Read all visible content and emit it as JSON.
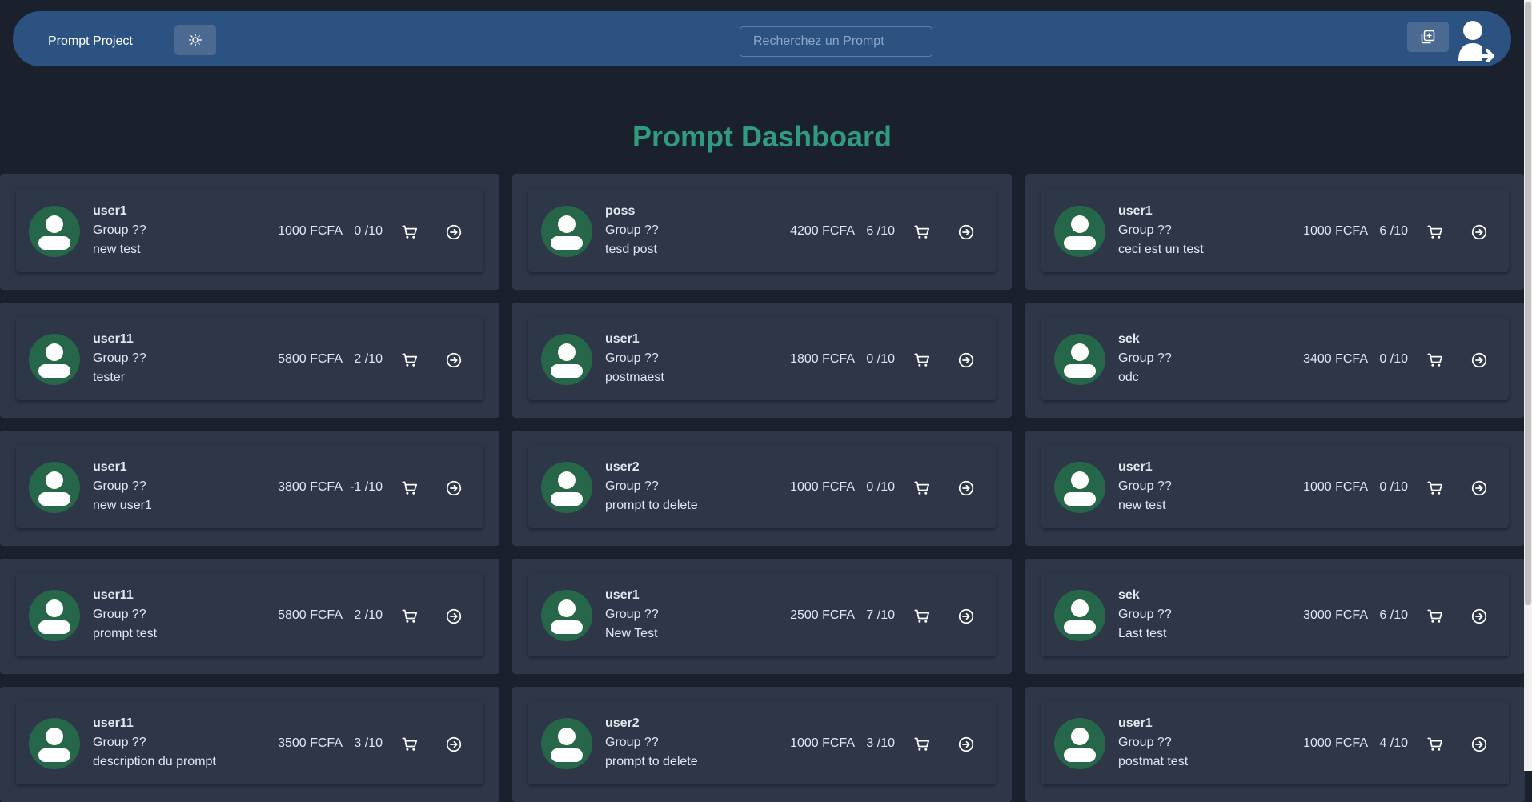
{
  "navbar": {
    "brand": "Prompt Project",
    "search_placeholder": "Recherchez un Prompt",
    "theme_icon": "sun-icon",
    "add_icon": "add-stack-icon",
    "user_icon": "user-logout-icon"
  },
  "page": {
    "title": "Prompt Dashboard"
  },
  "colors": {
    "background": "#1a202c",
    "navbar": "#2c5282",
    "card": "#2d3748",
    "title": "#319b7f",
    "avatar": "#276749"
  },
  "cards": [
    {
      "user": "user1",
      "group": "Group ??",
      "description": "new test",
      "price": "1000 FCFA",
      "rating": "0 /10"
    },
    {
      "user": "poss",
      "group": "Group ??",
      "description": "tesd post",
      "price": "4200 FCFA",
      "rating": "6 /10"
    },
    {
      "user": "user1",
      "group": "Group ??",
      "description": "ceci est un test",
      "price": "1000 FCFA",
      "rating": "6 /10"
    },
    {
      "user": "user11",
      "group": "Group ??",
      "description": "tester",
      "price": "5800 FCFA",
      "rating": "2 /10"
    },
    {
      "user": "user1",
      "group": "Group ??",
      "description": "postmaest",
      "price": "1800 FCFA",
      "rating": "0 /10"
    },
    {
      "user": "sek",
      "group": "Group ??",
      "description": "odc",
      "price": "3400 FCFA",
      "rating": "0 /10"
    },
    {
      "user": "user1",
      "group": "Group ??",
      "description": "new user1",
      "price": "3800 FCFA",
      "rating": "-1 /10"
    },
    {
      "user": "user2",
      "group": "Group ??",
      "description": "prompt to delete",
      "price": "1000 FCFA",
      "rating": "0 /10"
    },
    {
      "user": "user1",
      "group": "Group ??",
      "description": "new test",
      "price": "1000 FCFA",
      "rating": "0 /10"
    },
    {
      "user": "user11",
      "group": "Group ??",
      "description": "prompt test",
      "price": "5800 FCFA",
      "rating": "2 /10"
    },
    {
      "user": "user1",
      "group": "Group ??",
      "description": "New Test",
      "price": "2500 FCFA",
      "rating": "7 /10"
    },
    {
      "user": "sek",
      "group": "Group ??",
      "description": "Last test",
      "price": "3000 FCFA",
      "rating": "6 /10"
    },
    {
      "user": "user11",
      "group": "Group ??",
      "description": "description du prompt",
      "price": "3500 FCFA",
      "rating": "3 /10"
    },
    {
      "user": "user2",
      "group": "Group ??",
      "description": "prompt to delete",
      "price": "1000 FCFA",
      "rating": "3 /10"
    },
    {
      "user": "user1",
      "group": "Group ??",
      "description": "postmat test",
      "price": "1000 FCFA",
      "rating": "4 /10"
    }
  ],
  "card_icons": {
    "avatar": "user-avatar-icon",
    "cart": "cart-icon",
    "open": "arrow-circle-right-icon"
  }
}
